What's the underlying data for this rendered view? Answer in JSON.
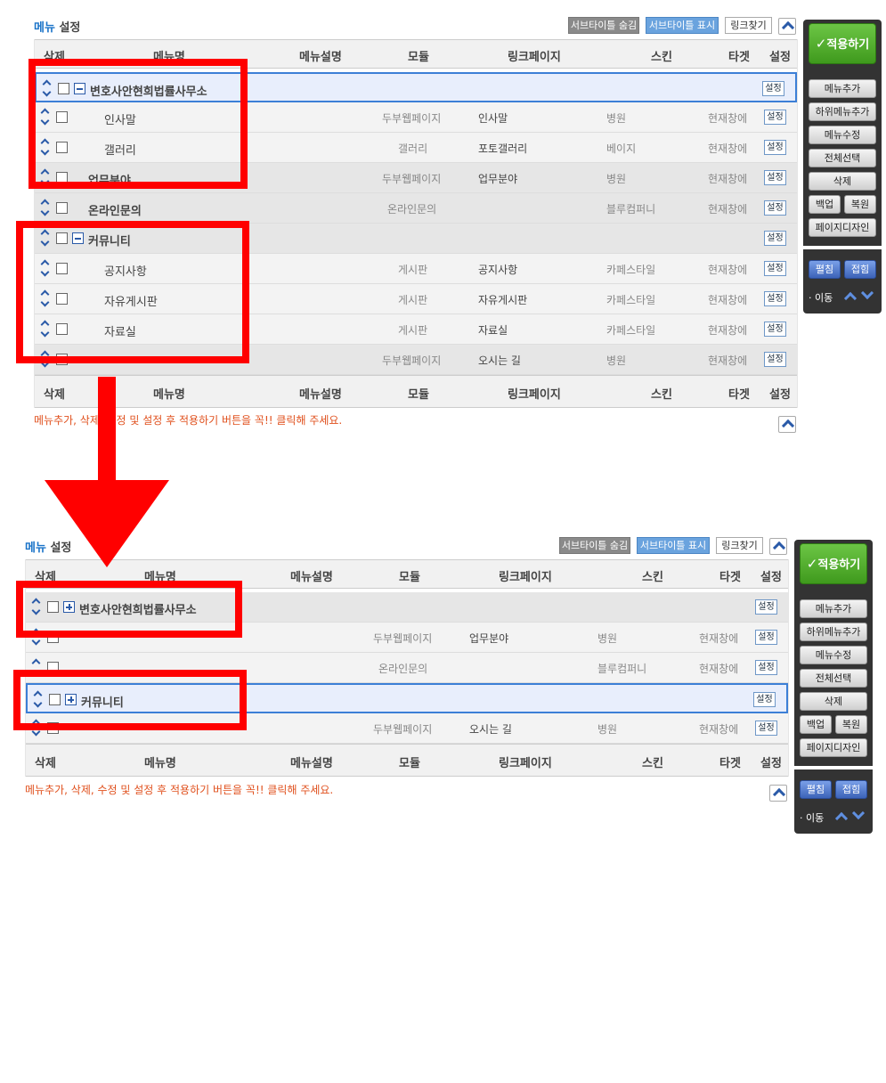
{
  "header": {
    "title_accent": "메뉴",
    "title_rest": "설정",
    "btn_hide_subtitle": "서브타이틀 숨김",
    "btn_show_subtitle": "서브타이틀 표시",
    "btn_find_link": "링크찾기"
  },
  "columns": [
    "삭제",
    "메뉴명",
    "메뉴설명",
    "모듈",
    "링크페이지",
    "스킨",
    "타겟",
    "설정"
  ],
  "set_label": "설정",
  "notice": "메뉴추가, 삭제, 수정 및 설정 후 적용하기 버튼을 꼭!! 클릭해 주세요.",
  "sidebar": {
    "apply": "적용하기",
    "apply_check": "✓",
    "add_menu": "메뉴추가",
    "add_submenu": "하위메뉴추가",
    "edit_menu": "메뉴수정",
    "select_all": "전체선택",
    "delete": "삭제",
    "backup": "백업",
    "restore": "복원",
    "page_design": "페이지디자인",
    "expand": "펼침",
    "collapse": "접힘",
    "move": "· 이동"
  },
  "before": {
    "rows": [
      {
        "name": "변호사안현희법률사무소",
        "desc": "",
        "module": "",
        "link": "",
        "skin": "",
        "target": ""
      },
      {
        "name": "인사말",
        "desc": "",
        "module": "두부웹페이지",
        "link": "인사말",
        "skin": "병원",
        "target": "현재창에"
      },
      {
        "name": "갤러리",
        "desc": "",
        "module": "갤러리",
        "link": "포토갤러리",
        "skin": "베이지",
        "target": "현재창에"
      },
      {
        "name": "업무분야",
        "desc": "",
        "module": "두부웹페이지",
        "link": "업무분야",
        "skin": "병원",
        "target": "현재창에"
      },
      {
        "name": "온라인문의",
        "desc": "",
        "module": "온라인문의",
        "link": "",
        "skin": "블루컴퍼니",
        "target": "현재창에"
      },
      {
        "name": "커뮤니티",
        "desc": "",
        "module": "",
        "link": "",
        "skin": "",
        "target": ""
      },
      {
        "name": "공지사항",
        "desc": "",
        "module": "게시판",
        "link": "공지사항",
        "skin": "카페스타일",
        "target": "현재창에"
      },
      {
        "name": "자유게시판",
        "desc": "",
        "module": "게시판",
        "link": "자유게시판",
        "skin": "카페스타일",
        "target": "현재창에"
      },
      {
        "name": "자료실",
        "desc": "",
        "module": "게시판",
        "link": "자료실",
        "skin": "카페스타일",
        "target": "현재창에"
      },
      {
        "name": "",
        "desc": "",
        "module": "두부웹페이지",
        "link": "오시는 길",
        "skin": "병원",
        "target": "현재창에"
      }
    ]
  },
  "after": {
    "rows": [
      {
        "name": "변호사안현희법률사무소",
        "desc": "",
        "module": "",
        "link": "",
        "skin": "",
        "target": ""
      },
      {
        "name": "",
        "desc": "",
        "module": "두부웹페이지",
        "link": "업무분야",
        "skin": "병원",
        "target": "현재창에"
      },
      {
        "name": "",
        "desc": "",
        "module": "온라인문의",
        "link": "",
        "skin": "블루컴퍼니",
        "target": "현재창에"
      },
      {
        "name": "커뮤니티",
        "desc": "",
        "module": "",
        "link": "",
        "skin": "",
        "target": ""
      },
      {
        "name": "",
        "desc": "",
        "module": "두부웹페이지",
        "link": "오시는 길",
        "skin": "병원",
        "target": "현재창에"
      }
    ]
  },
  "colors": {
    "accent_blue": "#1a73c8",
    "apply_green": "#4caf2a",
    "highlight_red": "#ff0000",
    "notice_orange": "#e0501d",
    "selected_row_border": "#3c7fd6"
  }
}
